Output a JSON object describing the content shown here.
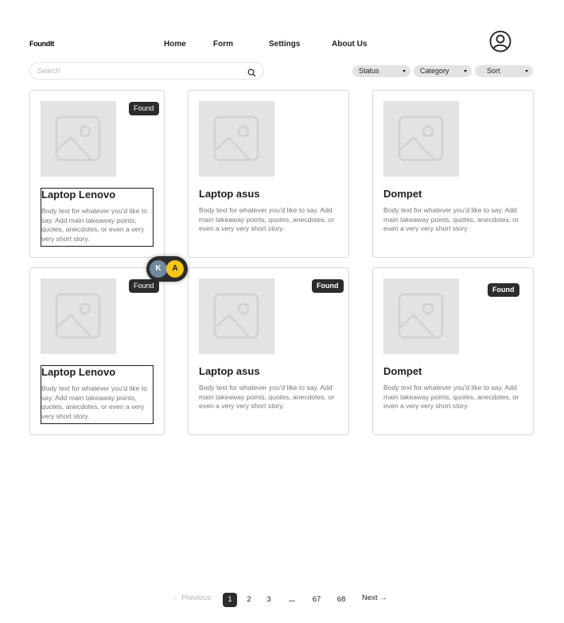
{
  "app": {
    "logo": "FoundIt"
  },
  "nav": {
    "home": "Home",
    "form": "Form",
    "settings": "Settings",
    "about": "About Us"
  },
  "header": {
    "avatar_icon": "user-circle-icon"
  },
  "search": {
    "placeholder": "Search",
    "value": "",
    "icon": "search-icon"
  },
  "filters": {
    "status": "Status",
    "category": "Category",
    "sort": "Sort"
  },
  "cards": [
    {
      "title": "Laptop Lenovo",
      "body": "Body text for whatever you'd like to say. Add main takeaway points, quotes, anecdotes, or even a very very short story.",
      "badge": "Found"
    },
    {
      "title": "Laptop asus",
      "body": "Body text for whatever you'd like to say. Add main takeaway points, quotes, anecdotes, or even a very very short story.",
      "badge": ""
    },
    {
      "title": "Dompet",
      "body": "Body text for whatever you'd like to say. Add main takeaway points, quotes, anecdotes, or even a very very short story.",
      "badge": ""
    },
    {
      "title": "Laptop Lenovo",
      "body": "Body text for whatever you'd like to say. Add main takeaway points, quotes, anecdotes, or even a very very short story.",
      "badge": "Found"
    },
    {
      "title": "Laptop asus",
      "body": "Body text for whatever you'd like to say. Add main takeaway points, quotes, anecdotes, or even a very very short story.",
      "badge": "Found"
    },
    {
      "title": "Dompet",
      "body": "Body text for whatever you'd like to say. Add main takeaway points, quotes, anecdotes, or even a very very short story.",
      "badge": "Found"
    }
  ],
  "presence": {
    "user1": "K",
    "user2": "A",
    "colors": {
      "user1": "#6f8a9e",
      "user2": "#f5c518"
    }
  },
  "pagination": {
    "previous": "← Previous",
    "pages": [
      "1",
      "2",
      "3",
      "...",
      "67",
      "68"
    ],
    "next": "Next →",
    "current": "1"
  },
  "colors": {
    "dark": "#2c2c2c",
    "muted": "#757575",
    "placeholder_bg": "#e3e3e3",
    "border": "#d9d9d9"
  }
}
